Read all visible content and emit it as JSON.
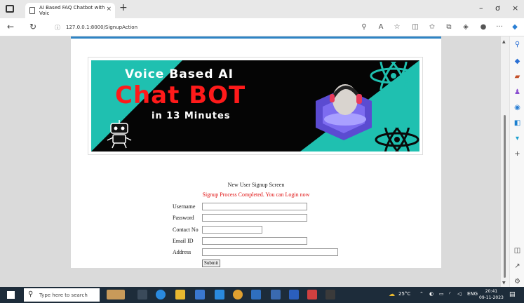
{
  "browser": {
    "tab_title": "AI Based FAQ Chatbot with Voic",
    "tab_close": "×",
    "new_tab": "+",
    "url": "127.0.0.1:8000/SignupAction",
    "win_min": "–",
    "win_max": "ơ",
    "win_close": "×",
    "more": "···"
  },
  "banner": {
    "line1": "Voice Based AI",
    "line2": "Chat BOT",
    "line3": "in 13 Minutes"
  },
  "form": {
    "title": "New User Signup Screen",
    "message": "Signup Process Completed. You can Login now",
    "username_label": "Username",
    "password_label": "Password",
    "contact_label": "Contact No",
    "email_label": "Email ID",
    "address_label": "Address",
    "submit_label": "Submit"
  },
  "taskbar": {
    "search_placeholder": "Type here to search",
    "temperature": "25°C",
    "language": "ENG",
    "time": "20:41",
    "date": "09-11-2023"
  },
  "colors": {
    "accent_bar": "#2f84c4",
    "message_red": "#e01010",
    "banner_teal": "#1fc0b0",
    "banner_red": "#ff1a1a"
  }
}
